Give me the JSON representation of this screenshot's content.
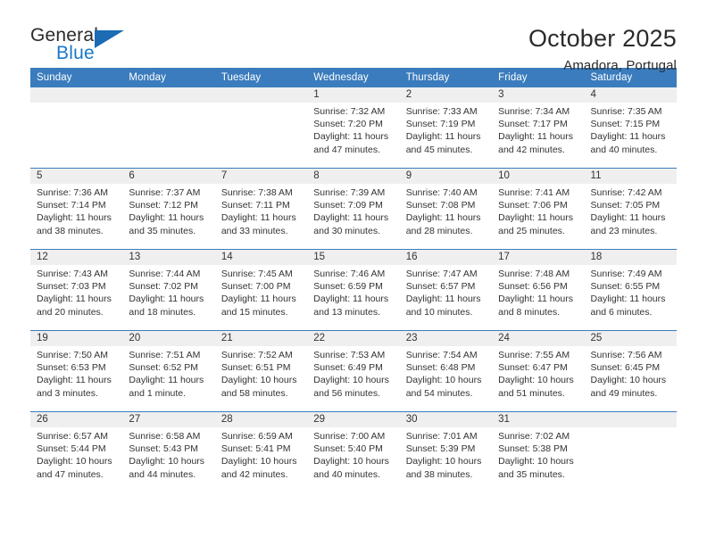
{
  "brand": {
    "name_top": "General",
    "name_bottom": "Blue",
    "accent_color": "#1878c8",
    "triangle_color": "#1b6bb5"
  },
  "header": {
    "title": "October 2025",
    "subtitle": "Amadora, Portugal"
  },
  "theme": {
    "header_blue": "#3a7cbd",
    "daynum_band": "#efefef",
    "text": "#333333"
  },
  "weekday_headers": [
    "Sunday",
    "Monday",
    "Tuesday",
    "Wednesday",
    "Thursday",
    "Friday",
    "Saturday"
  ],
  "labels": {
    "sunrise": "Sunrise:",
    "sunset": "Sunset:",
    "daylight": "Daylight:"
  },
  "weeks": [
    [
      {
        "day": "",
        "empty": true
      },
      {
        "day": "",
        "empty": true
      },
      {
        "day": "",
        "empty": true
      },
      {
        "day": "1",
        "sunrise": "Sunrise: 7:32 AM",
        "sunset": "Sunset: 7:20 PM",
        "daylight1": "Daylight: 11 hours",
        "daylight2": "and 47 minutes."
      },
      {
        "day": "2",
        "sunrise": "Sunrise: 7:33 AM",
        "sunset": "Sunset: 7:19 PM",
        "daylight1": "Daylight: 11 hours",
        "daylight2": "and 45 minutes."
      },
      {
        "day": "3",
        "sunrise": "Sunrise: 7:34 AM",
        "sunset": "Sunset: 7:17 PM",
        "daylight1": "Daylight: 11 hours",
        "daylight2": "and 42 minutes."
      },
      {
        "day": "4",
        "sunrise": "Sunrise: 7:35 AM",
        "sunset": "Sunset: 7:15 PM",
        "daylight1": "Daylight: 11 hours",
        "daylight2": "and 40 minutes."
      }
    ],
    [
      {
        "day": "5",
        "sunrise": "Sunrise: 7:36 AM",
        "sunset": "Sunset: 7:14 PM",
        "daylight1": "Daylight: 11 hours",
        "daylight2": "and 38 minutes."
      },
      {
        "day": "6",
        "sunrise": "Sunrise: 7:37 AM",
        "sunset": "Sunset: 7:12 PM",
        "daylight1": "Daylight: 11 hours",
        "daylight2": "and 35 minutes."
      },
      {
        "day": "7",
        "sunrise": "Sunrise: 7:38 AM",
        "sunset": "Sunset: 7:11 PM",
        "daylight1": "Daylight: 11 hours",
        "daylight2": "and 33 minutes."
      },
      {
        "day": "8",
        "sunrise": "Sunrise: 7:39 AM",
        "sunset": "Sunset: 7:09 PM",
        "daylight1": "Daylight: 11 hours",
        "daylight2": "and 30 minutes."
      },
      {
        "day": "9",
        "sunrise": "Sunrise: 7:40 AM",
        "sunset": "Sunset: 7:08 PM",
        "daylight1": "Daylight: 11 hours",
        "daylight2": "and 28 minutes."
      },
      {
        "day": "10",
        "sunrise": "Sunrise: 7:41 AM",
        "sunset": "Sunset: 7:06 PM",
        "daylight1": "Daylight: 11 hours",
        "daylight2": "and 25 minutes."
      },
      {
        "day": "11",
        "sunrise": "Sunrise: 7:42 AM",
        "sunset": "Sunset: 7:05 PM",
        "daylight1": "Daylight: 11 hours",
        "daylight2": "and 23 minutes."
      }
    ],
    [
      {
        "day": "12",
        "sunrise": "Sunrise: 7:43 AM",
        "sunset": "Sunset: 7:03 PM",
        "daylight1": "Daylight: 11 hours",
        "daylight2": "and 20 minutes."
      },
      {
        "day": "13",
        "sunrise": "Sunrise: 7:44 AM",
        "sunset": "Sunset: 7:02 PM",
        "daylight1": "Daylight: 11 hours",
        "daylight2": "and 18 minutes."
      },
      {
        "day": "14",
        "sunrise": "Sunrise: 7:45 AM",
        "sunset": "Sunset: 7:00 PM",
        "daylight1": "Daylight: 11 hours",
        "daylight2": "and 15 minutes."
      },
      {
        "day": "15",
        "sunrise": "Sunrise: 7:46 AM",
        "sunset": "Sunset: 6:59 PM",
        "daylight1": "Daylight: 11 hours",
        "daylight2": "and 13 minutes."
      },
      {
        "day": "16",
        "sunrise": "Sunrise: 7:47 AM",
        "sunset": "Sunset: 6:57 PM",
        "daylight1": "Daylight: 11 hours",
        "daylight2": "and 10 minutes."
      },
      {
        "day": "17",
        "sunrise": "Sunrise: 7:48 AM",
        "sunset": "Sunset: 6:56 PM",
        "daylight1": "Daylight: 11 hours",
        "daylight2": "and 8 minutes."
      },
      {
        "day": "18",
        "sunrise": "Sunrise: 7:49 AM",
        "sunset": "Sunset: 6:55 PM",
        "daylight1": "Daylight: 11 hours",
        "daylight2": "and 6 minutes."
      }
    ],
    [
      {
        "day": "19",
        "sunrise": "Sunrise: 7:50 AM",
        "sunset": "Sunset: 6:53 PM",
        "daylight1": "Daylight: 11 hours",
        "daylight2": "and 3 minutes."
      },
      {
        "day": "20",
        "sunrise": "Sunrise: 7:51 AM",
        "sunset": "Sunset: 6:52 PM",
        "daylight1": "Daylight: 11 hours",
        "daylight2": "and 1 minute."
      },
      {
        "day": "21",
        "sunrise": "Sunrise: 7:52 AM",
        "sunset": "Sunset: 6:51 PM",
        "daylight1": "Daylight: 10 hours",
        "daylight2": "and 58 minutes."
      },
      {
        "day": "22",
        "sunrise": "Sunrise: 7:53 AM",
        "sunset": "Sunset: 6:49 PM",
        "daylight1": "Daylight: 10 hours",
        "daylight2": "and 56 minutes."
      },
      {
        "day": "23",
        "sunrise": "Sunrise: 7:54 AM",
        "sunset": "Sunset: 6:48 PM",
        "daylight1": "Daylight: 10 hours",
        "daylight2": "and 54 minutes."
      },
      {
        "day": "24",
        "sunrise": "Sunrise: 7:55 AM",
        "sunset": "Sunset: 6:47 PM",
        "daylight1": "Daylight: 10 hours",
        "daylight2": "and 51 minutes."
      },
      {
        "day": "25",
        "sunrise": "Sunrise: 7:56 AM",
        "sunset": "Sunset: 6:45 PM",
        "daylight1": "Daylight: 10 hours",
        "daylight2": "and 49 minutes."
      }
    ],
    [
      {
        "day": "26",
        "sunrise": "Sunrise: 6:57 AM",
        "sunset": "Sunset: 5:44 PM",
        "daylight1": "Daylight: 10 hours",
        "daylight2": "and 47 minutes."
      },
      {
        "day": "27",
        "sunrise": "Sunrise: 6:58 AM",
        "sunset": "Sunset: 5:43 PM",
        "daylight1": "Daylight: 10 hours",
        "daylight2": "and 44 minutes."
      },
      {
        "day": "28",
        "sunrise": "Sunrise: 6:59 AM",
        "sunset": "Sunset: 5:41 PM",
        "daylight1": "Daylight: 10 hours",
        "daylight2": "and 42 minutes."
      },
      {
        "day": "29",
        "sunrise": "Sunrise: 7:00 AM",
        "sunset": "Sunset: 5:40 PM",
        "daylight1": "Daylight: 10 hours",
        "daylight2": "and 40 minutes."
      },
      {
        "day": "30",
        "sunrise": "Sunrise: 7:01 AM",
        "sunset": "Sunset: 5:39 PM",
        "daylight1": "Daylight: 10 hours",
        "daylight2": "and 38 minutes."
      },
      {
        "day": "31",
        "sunrise": "Sunrise: 7:02 AM",
        "sunset": "Sunset: 5:38 PM",
        "daylight1": "Daylight: 10 hours",
        "daylight2": "and 35 minutes."
      },
      {
        "day": "",
        "empty": true
      }
    ]
  ]
}
